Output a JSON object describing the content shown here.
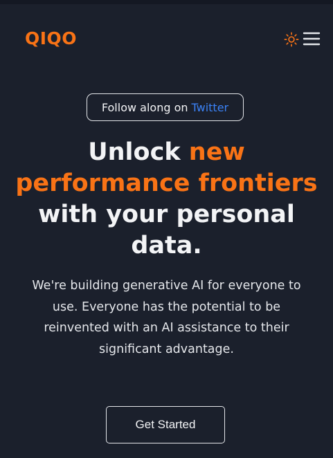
{
  "brand": {
    "name": "QIQO",
    "accent": "#f97316"
  },
  "header": {
    "theme_icon": "sun-icon",
    "menu_icon": "hamburger-menu-icon"
  },
  "announcement": {
    "text": "Follow along on",
    "link_text": "Twitter",
    "link_color": "#3b82f6"
  },
  "hero": {
    "headline_part1": "Unlock",
    "headline_accent": "new performance frontiers",
    "headline_part2": "with your personal data.",
    "description": "We're building generative AI for everyone to use. Everyone has the potential to be reinvented with an AI assistance to their significant advantage.",
    "cta_label": "Get Started"
  },
  "colors": {
    "background": "#1b202c",
    "text": "#f3f4f6"
  }
}
